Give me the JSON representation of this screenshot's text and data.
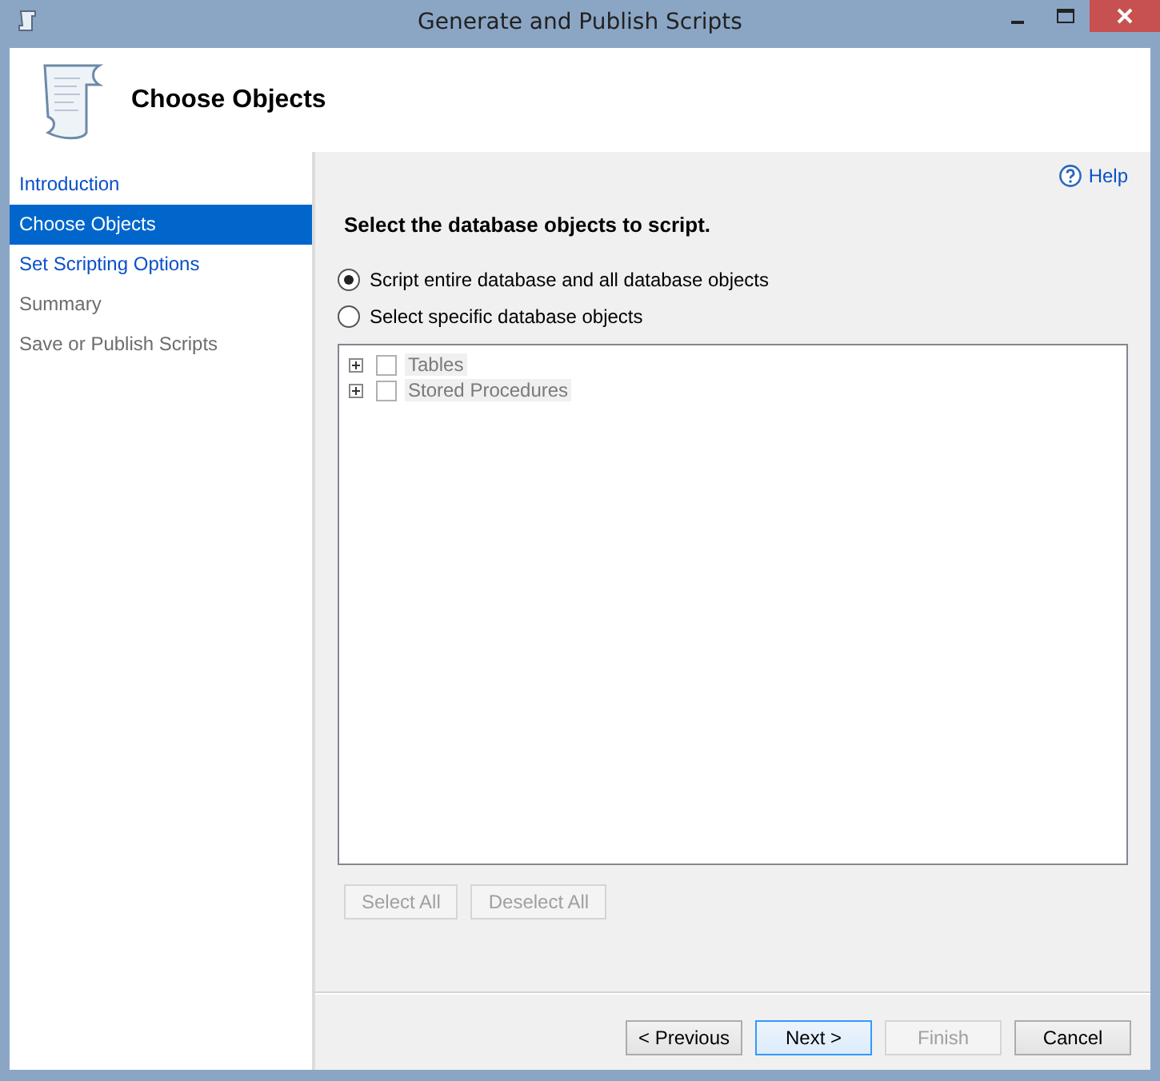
{
  "window": {
    "title": "Generate and Publish Scripts"
  },
  "header": {
    "title": "Choose Objects"
  },
  "sidebar": {
    "items": [
      {
        "label": "Introduction",
        "selected": false,
        "disabled": false
      },
      {
        "label": "Choose Objects",
        "selected": true,
        "disabled": false
      },
      {
        "label": "Set Scripting Options",
        "selected": false,
        "disabled": false
      },
      {
        "label": "Summary",
        "selected": false,
        "disabled": true
      },
      {
        "label": "Save or Publish Scripts",
        "selected": false,
        "disabled": true
      }
    ]
  },
  "help": {
    "label": "Help"
  },
  "heading": "Select the database objects to script.",
  "options": [
    {
      "label": "Script entire database and all database objects",
      "selected": true
    },
    {
      "label": "Select specific database objects",
      "selected": false
    }
  ],
  "tree": {
    "disabled": true,
    "items": [
      {
        "label": "Tables",
        "checked": false,
        "expanded": false
      },
      {
        "label": "Stored Procedures",
        "checked": false,
        "expanded": false
      }
    ]
  },
  "tree_buttons": [
    {
      "label": "Select All",
      "disabled": true
    },
    {
      "label": "Deselect All",
      "disabled": true
    }
  ],
  "footer_buttons": [
    {
      "label": "< Previous",
      "disabled": false,
      "default": false
    },
    {
      "label": "Next >",
      "disabled": false,
      "default": true
    },
    {
      "label": "Finish",
      "disabled": true,
      "default": false
    },
    {
      "label": "Cancel",
      "disabled": false,
      "default": false
    }
  ]
}
